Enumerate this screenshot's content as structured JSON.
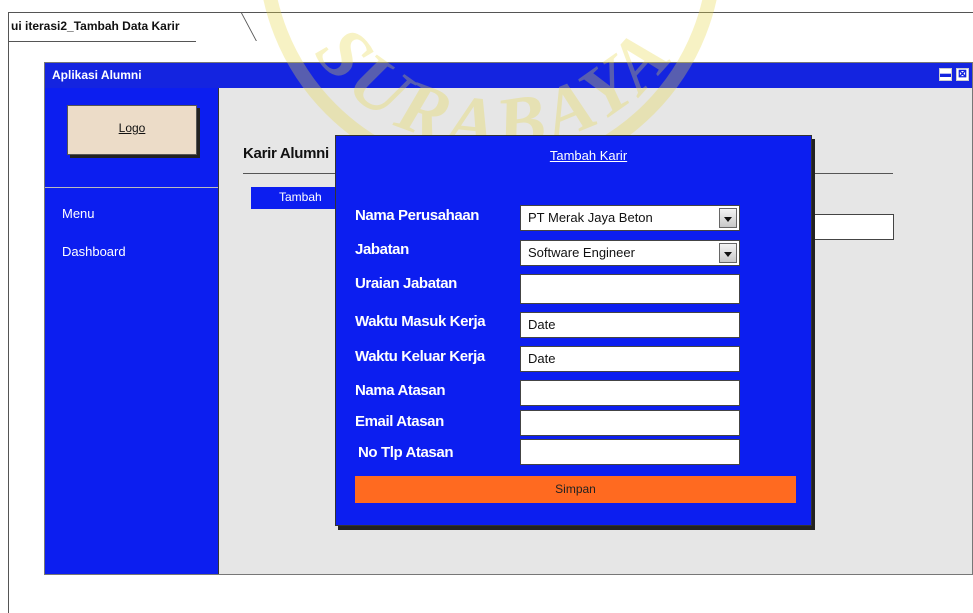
{
  "frame": {
    "tab_label": "ui iterasi2_Tambah Data Karir"
  },
  "watermark": {
    "text": "SURABAYA"
  },
  "window": {
    "title": "Aplikasi Alumni",
    "maximize_glyph": "▬",
    "close_glyph": "⊠"
  },
  "sidebar": {
    "logo_label": "Logo",
    "items": [
      {
        "label": "Menu"
      },
      {
        "label": "Dashboard"
      }
    ]
  },
  "main": {
    "title": "Karir Alumni",
    "tambah_label": "Tambah"
  },
  "modal": {
    "title": "Tambah Karir",
    "fields": [
      {
        "label": "Nama Perusahaan",
        "value": "PT Merak Jaya Beton",
        "type": "select"
      },
      {
        "label": "Jabatan",
        "value": "Software Engineer",
        "type": "select"
      },
      {
        "label": "Uraian Jabatan",
        "value": "",
        "type": "text"
      },
      {
        "label": "Waktu Masuk Kerja",
        "value": "Date",
        "type": "date"
      },
      {
        "label": "Waktu Keluar Kerja",
        "value": "Date",
        "type": "date"
      },
      {
        "label": "Nama Atasan",
        "value": "",
        "type": "text"
      },
      {
        "label": "Email Atasan",
        "value": "",
        "type": "text"
      },
      {
        "label": "No Tlp Atasan",
        "value": "",
        "type": "text"
      }
    ],
    "submit_label": "Simpan"
  },
  "colors": {
    "accent_blue": "#0c1ef0",
    "submit_orange": "#ff6a20",
    "logo_bg": "#ecdcc8",
    "watermark_yellow": "#e8d84a"
  }
}
